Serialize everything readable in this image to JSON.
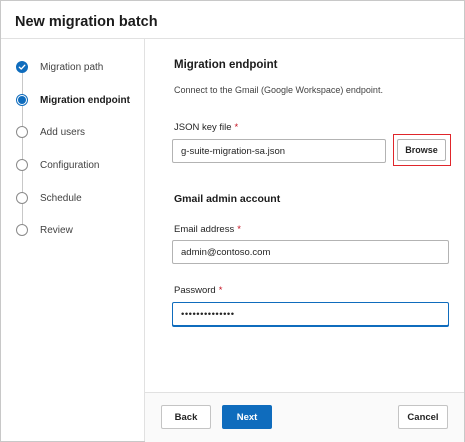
{
  "dialog": {
    "title": "New migration batch"
  },
  "steps": [
    {
      "label": "Migration path",
      "state": "completed"
    },
    {
      "label": "Migration endpoint",
      "state": "current"
    },
    {
      "label": "Add users",
      "state": "pending"
    },
    {
      "label": "Configuration",
      "state": "pending"
    },
    {
      "label": "Schedule",
      "state": "pending"
    },
    {
      "label": "Review",
      "state": "pending"
    }
  ],
  "content": {
    "heading": "Migration endpoint",
    "description": "Connect to the Gmail (Google Workspace) endpoint.",
    "json_key": {
      "label": "JSON key file",
      "required_mark": "*",
      "value": "g-suite-migration-sa.json",
      "browse_label": "Browse"
    },
    "admin_section": "Gmail admin account",
    "email": {
      "label": "Email address",
      "required_mark": "*",
      "value": "admin@contoso.com"
    },
    "password": {
      "label": "Password",
      "required_mark": "*",
      "value": "••••••••••••••"
    }
  },
  "footer": {
    "back_label": "Back",
    "next_label": "Next",
    "cancel_label": "Cancel"
  },
  "colors": {
    "accent": "#0f6cbd",
    "highlight_box": "#e0262b",
    "required": "#c50f1f"
  }
}
